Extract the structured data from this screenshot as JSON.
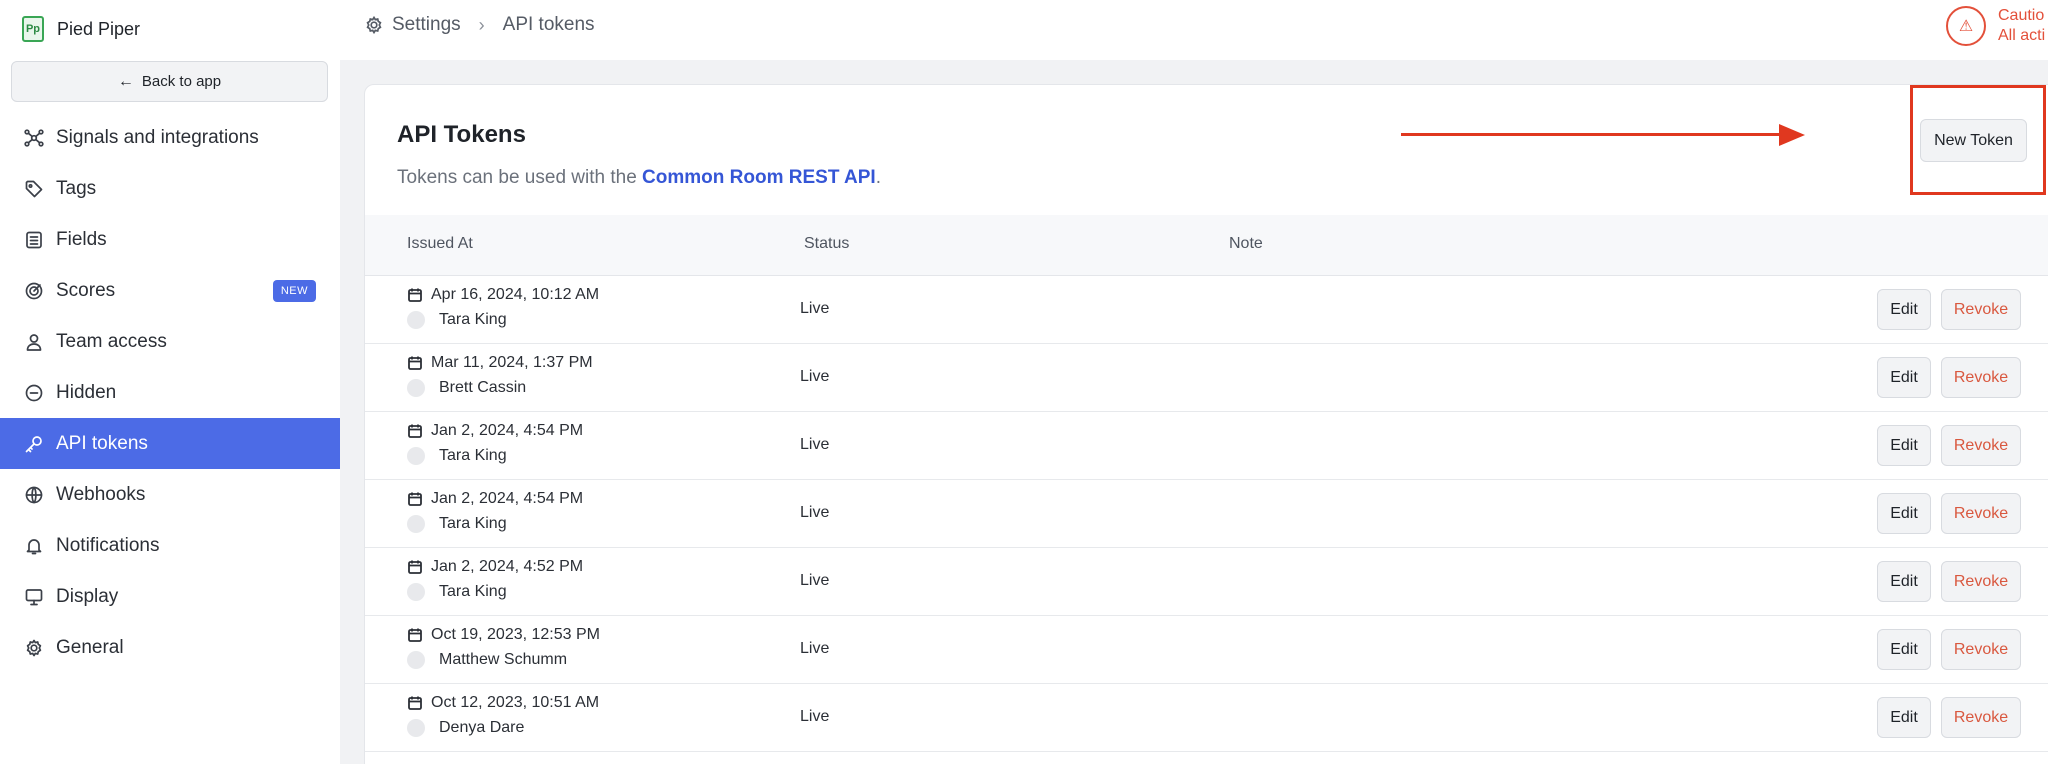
{
  "brand": {
    "name": "Pied Piper",
    "logo_text": "Pp"
  },
  "sidebar": {
    "back_label": "Back to app",
    "items": [
      {
        "label": "Signals and integrations",
        "icon": "share-nodes-icon"
      },
      {
        "label": "Tags",
        "icon": "tag-icon"
      },
      {
        "label": "Fields",
        "icon": "list-icon"
      },
      {
        "label": "Scores",
        "icon": "target-icon",
        "badge": "NEW"
      },
      {
        "label": "Team access",
        "icon": "user-icon"
      },
      {
        "label": "Hidden",
        "icon": "minus-circle-icon"
      },
      {
        "label": "API tokens",
        "icon": "key-icon",
        "active": true
      },
      {
        "label": "Webhooks",
        "icon": "globe-icon"
      },
      {
        "label": "Notifications",
        "icon": "bell-icon"
      },
      {
        "label": "Display",
        "icon": "monitor-icon"
      },
      {
        "label": "General",
        "icon": "gear-icon"
      }
    ]
  },
  "header": {
    "breadcrumb_root": "Settings",
    "breadcrumb_current": "API tokens",
    "caution_line1": "Cautio",
    "caution_line2": "All acti"
  },
  "card": {
    "title": "API Tokens",
    "subtitle_prefix": "Tokens can be used with the ",
    "subtitle_link": "Common Room REST API",
    "subtitle_suffix": ".",
    "new_token_label": "New Token"
  },
  "table": {
    "headers": {
      "issued_at": "Issued At",
      "status": "Status",
      "note": "Note"
    },
    "edit_label": "Edit",
    "revoke_label": "Revoke",
    "rows": [
      {
        "date": "Apr 16, 2024, 10:12 AM",
        "user": "Tara King",
        "status": "Live"
      },
      {
        "date": "Mar 11, 2024, 1:37 PM",
        "user": "Brett Cassin",
        "status": "Live"
      },
      {
        "date": "Jan 2, 2024, 4:54 PM",
        "user": "Tara King",
        "status": "Live"
      },
      {
        "date": "Jan 2, 2024, 4:54 PM",
        "user": "Tara King",
        "status": "Live"
      },
      {
        "date": "Jan 2, 2024, 4:52 PM",
        "user": "Tara King",
        "status": "Live"
      },
      {
        "date": "Oct 19, 2023, 12:53 PM",
        "user": "Matthew Schumm",
        "status": "Live"
      },
      {
        "date": "Oct 12, 2023, 10:51 AM",
        "user": "Denya Dare",
        "status": "Live"
      }
    ]
  },
  "colors": {
    "accent": "#4c6be6",
    "annotation": "#e0381f",
    "danger": "#d9583f"
  }
}
